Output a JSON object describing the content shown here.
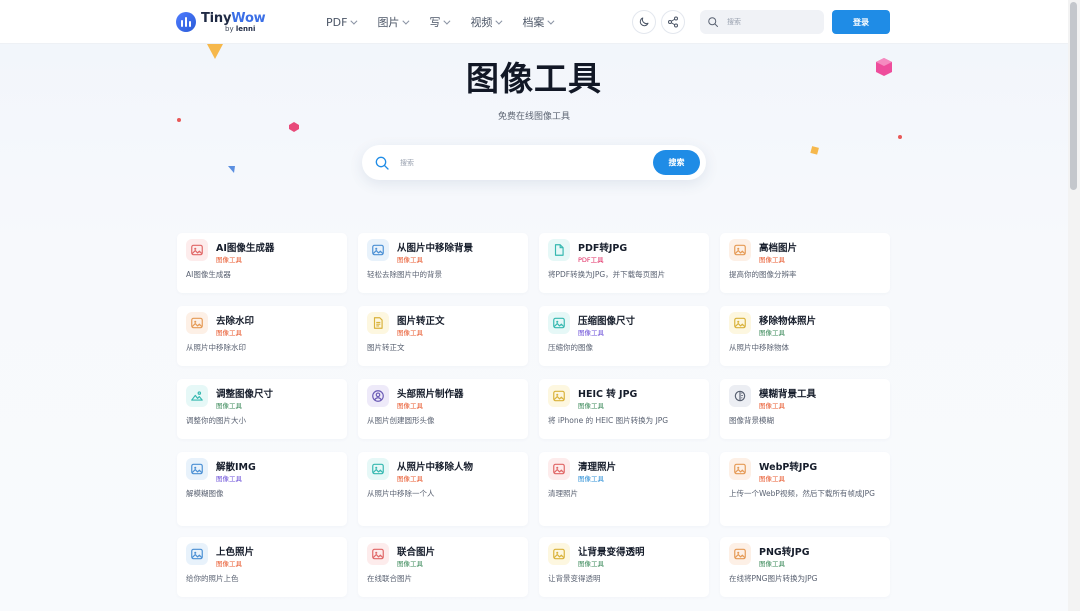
{
  "header": {
    "logo_brand": "Tiny",
    "logo_brand_accent": "Wow",
    "logo_by": "by",
    "logo_by_name": "lenni",
    "nav": [
      "PDF",
      "图片",
      "写",
      "视频",
      "档案"
    ],
    "search_placeholder": "搜索",
    "login_label": "登录"
  },
  "hero": {
    "title": "图像工具",
    "subtitle": "免费在线图像工具",
    "search_placeholder": "搜索",
    "search_button": "搜索"
  },
  "colors": {
    "accent": "#1f8ce6",
    "cat_image_1": "#e8582d",
    "cat_image_2": "#3b8a5a",
    "cat_image_3": "#6b4fd8",
    "cat_image_4": "#2c8fd6",
    "cat_pdf": "#e0245e"
  },
  "cards": [
    {
      "title": "AI图像生成器",
      "category": "图像工具",
      "desc": "AI图像生成器",
      "icon": "image-icon",
      "color": "#e8582d",
      "bg": "#fdecec",
      "stroke": "#e06666"
    },
    {
      "title": "从图片中移除背景",
      "category": "图像工具",
      "desc": "轻松去除图片中的背景",
      "icon": "image-icon",
      "color": "#e8582d",
      "bg": "#e8f2fb",
      "stroke": "#4a8fd4"
    },
    {
      "title": "PDF转JPG",
      "category": "PDF工具",
      "desc": "将PDF转换为JPG，并下载每页图片",
      "icon": "file-icon",
      "color": "#e0245e",
      "bg": "#e6f8f7",
      "stroke": "#35b8b0"
    },
    {
      "title": "高档图片",
      "category": "图像工具",
      "desc": "提高你的图像分辨率",
      "icon": "image-icon",
      "color": "#e8582d",
      "bg": "#fdf0e6",
      "stroke": "#e59a55"
    },
    {
      "title": "去除水印",
      "category": "图像工具",
      "desc": "从照片中移除水印",
      "icon": "image-icon",
      "color": "#e8582d",
      "bg": "#fdf0e6",
      "stroke": "#e59a55"
    },
    {
      "title": "图片转正文",
      "category": "图像工具",
      "desc": "图片转正文",
      "icon": "document-icon",
      "color": "#e8582d",
      "bg": "#fdf7e0",
      "stroke": "#d9b23a"
    },
    {
      "title": "压缩图像尺寸",
      "category": "图像工具",
      "desc": "压缩你的图像",
      "icon": "image-icon",
      "color": "#6b4fd8",
      "bg": "#e6f8f7",
      "stroke": "#35b8b0"
    },
    {
      "title": "移除物体照片",
      "category": "图像工具",
      "desc": "从照片中移除物体",
      "icon": "image-icon",
      "color": "#3b8a5a",
      "bg": "#fdf7e0",
      "stroke": "#d9b23a"
    },
    {
      "title": "调整图像尺寸",
      "category": "图像工具",
      "desc": "调整你的图片大小",
      "icon": "landscape-icon",
      "color": "#3b8a5a",
      "bg": "#e6f8f7",
      "stroke": "#35b8b0"
    },
    {
      "title": "头部照片制作器",
      "category": "图像工具",
      "desc": "从图片创建圆形头像",
      "icon": "user-circle-icon",
      "color": "#e8582d",
      "bg": "#eeeaf9",
      "stroke": "#6b5bb5"
    },
    {
      "title": "HEIC 转 JPG",
      "category": "图像工具",
      "desc": "将 iPhone 的 HEIC 图片转换为 JPG",
      "icon": "image-icon",
      "color": "#3b8a5a",
      "bg": "#fdf7e0",
      "stroke": "#d9b23a"
    },
    {
      "title": "模糊背景工具",
      "category": "图像工具",
      "desc": "图像背景模糊",
      "icon": "blur-icon",
      "color": "#e8582d",
      "bg": "#eceef3",
      "stroke": "#5a6272"
    },
    {
      "title": "解散IMG",
      "category": "图像工具",
      "desc": "解模糊图像",
      "icon": "image-icon",
      "color": "#6b4fd8",
      "bg": "#e8f2fb",
      "stroke": "#4a8fd4"
    },
    {
      "title": "从照片中移除人物",
      "category": "图像工具",
      "desc": "从照片中移除一个人",
      "icon": "image-icon",
      "color": "#e8582d",
      "bg": "#e6f8f7",
      "stroke": "#35b8b0"
    },
    {
      "title": "清理照片",
      "category": "图像工具",
      "desc": "清理照片",
      "icon": "image-icon",
      "color": "#2c8fd6",
      "bg": "#fdecec",
      "stroke": "#e06666"
    },
    {
      "title": "WebP转JPG",
      "category": "图像工具",
      "desc": "上传一个WebP视频，然后下载所有帧成JPG",
      "icon": "image-icon",
      "color": "#e8582d",
      "bg": "#fdf0e6",
      "stroke": "#e59a55"
    },
    {
      "title": "上色照片",
      "category": "图像工具",
      "desc": "给你的照片上色",
      "icon": "image-icon",
      "color": "#e8582d",
      "bg": "#e8f2fb",
      "stroke": "#4a8fd4"
    },
    {
      "title": "联合图片",
      "category": "图像工具",
      "desc": "在线联合图片",
      "icon": "image-icon",
      "color": "#3b8a5a",
      "bg": "#fdecec",
      "stroke": "#e06666"
    },
    {
      "title": "让背景变得透明",
      "category": "图像工具",
      "desc": "让背景变得透明",
      "icon": "image-icon",
      "color": "#3b8a5a",
      "bg": "#fdf7e0",
      "stroke": "#d9b23a"
    },
    {
      "title": "PNG转JPG",
      "category": "图像工具",
      "desc": "在线将PNG图片转换为JPG",
      "icon": "image-icon",
      "color": "#3b8a5a",
      "bg": "#fdf0e6",
      "stroke": "#e59a55"
    }
  ]
}
